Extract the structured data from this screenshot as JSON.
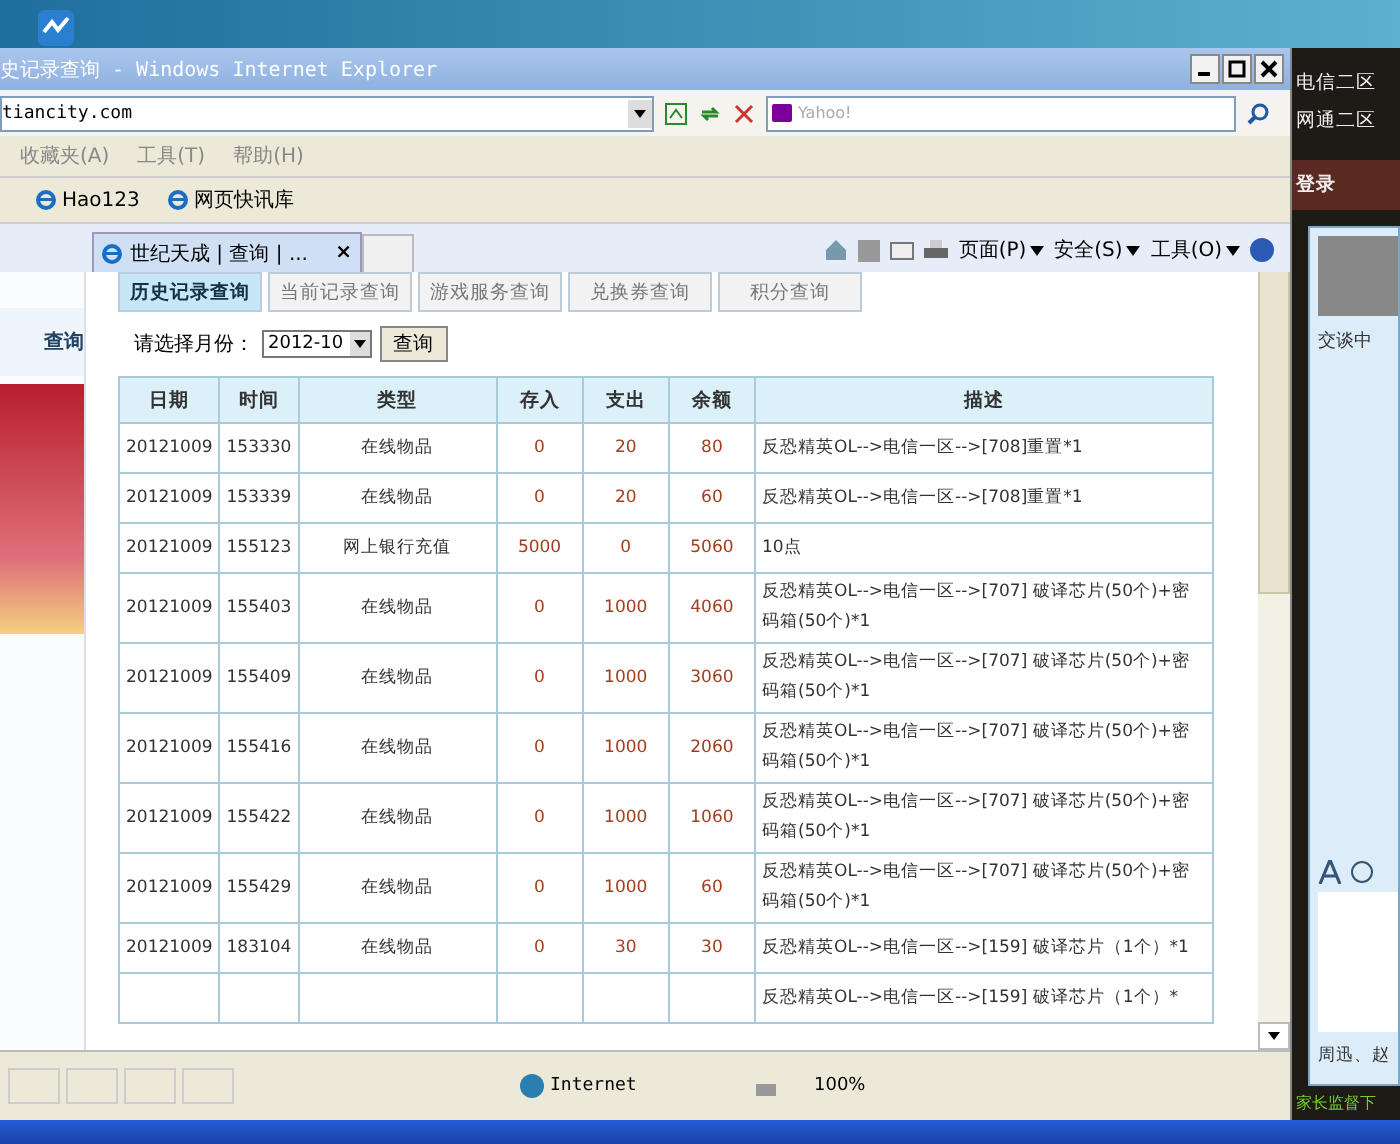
{
  "window": {
    "title": "史记录查询 - Windows Internet Explorer"
  },
  "address_bar": {
    "value": "tiancity.com",
    "search_placeholder": "Yahoo!"
  },
  "menu": [
    "收藏夹(A)",
    "工具(T)",
    "帮助(H)"
  ],
  "favorites": [
    "Hao123",
    "网页快讯库"
  ],
  "browser_tab": {
    "label": "世纪天成 | 查询 | ...",
    "close": "×"
  },
  "command_bar": [
    "页面(P)",
    "安全(S)",
    "工具(O)"
  ],
  "sidebar": {
    "heading": "查询"
  },
  "query_tabs": [
    {
      "label": "历史记录查询",
      "selected": true
    },
    {
      "label": "当前记录查询",
      "selected": false
    },
    {
      "label": "游戏服务查询",
      "selected": false
    },
    {
      "label": "兑换券查询",
      "selected": false
    },
    {
      "label": "积分查询",
      "selected": false
    }
  ],
  "month_filter": {
    "label": "请选择月份：",
    "value": "2012-10",
    "button": "查询"
  },
  "table": {
    "columns": [
      "日期",
      "时间",
      "类型",
      "存入",
      "支出",
      "余额",
      "描述"
    ],
    "rows": [
      {
        "date": "20121009",
        "time": "153330",
        "type": "在线物品",
        "in": "0",
        "out": "20",
        "balance": "80",
        "desc": "反恐精英OL-->电信一区-->[708]重置*1"
      },
      {
        "date": "20121009",
        "time": "153339",
        "type": "在线物品",
        "in": "0",
        "out": "20",
        "balance": "60",
        "desc": "反恐精英OL-->电信一区-->[708]重置*1"
      },
      {
        "date": "20121009",
        "time": "155123",
        "type": "网上银行充值",
        "in": "5000",
        "out": "0",
        "balance": "5060",
        "desc": "10点"
      },
      {
        "date": "20121009",
        "time": "155403",
        "type": "在线物品",
        "in": "0",
        "out": "1000",
        "balance": "4060",
        "desc": "反恐精英OL-->电信一区-->[707] 破译芯片(50个)+密码箱(50个)*1"
      },
      {
        "date": "20121009",
        "time": "155409",
        "type": "在线物品",
        "in": "0",
        "out": "1000",
        "balance": "3060",
        "desc": "反恐精英OL-->电信一区-->[707] 破译芯片(50个)+密码箱(50个)*1"
      },
      {
        "date": "20121009",
        "time": "155416",
        "type": "在线物品",
        "in": "0",
        "out": "1000",
        "balance": "2060",
        "desc": "反恐精英OL-->电信一区-->[707] 破译芯片(50个)+密码箱(50个)*1"
      },
      {
        "date": "20121009",
        "time": "155422",
        "type": "在线物品",
        "in": "0",
        "out": "1000",
        "balance": "1060",
        "desc": "反恐精英OL-->电信一区-->[707] 破译芯片(50个)+密码箱(50个)*1"
      },
      {
        "date": "20121009",
        "time": "155429",
        "type": "在线物品",
        "in": "0",
        "out": "1000",
        "balance": "60",
        "desc": "反恐精英OL-->电信一区-->[707] 破译芯片(50个)+密码箱(50个)*1"
      },
      {
        "date": "20121009",
        "time": "183104",
        "type": "在线物品",
        "in": "0",
        "out": "30",
        "balance": "30",
        "desc": "反恐精英OL-->电信一区-->[159] 破译芯片（1个）*1"
      },
      {
        "desc": "反恐精英OL-->电信一区-->[159] 破译芯片（1个）*"
      }
    ]
  },
  "status_bar": {
    "zone": "Internet",
    "zoom": "100%"
  },
  "side_app": {
    "servers": [
      "电信二区",
      "网通二区"
    ],
    "login": "登录",
    "chat_status": "交谈中",
    "contacts": "周迅、赵",
    "notice": "家长监督下"
  }
}
